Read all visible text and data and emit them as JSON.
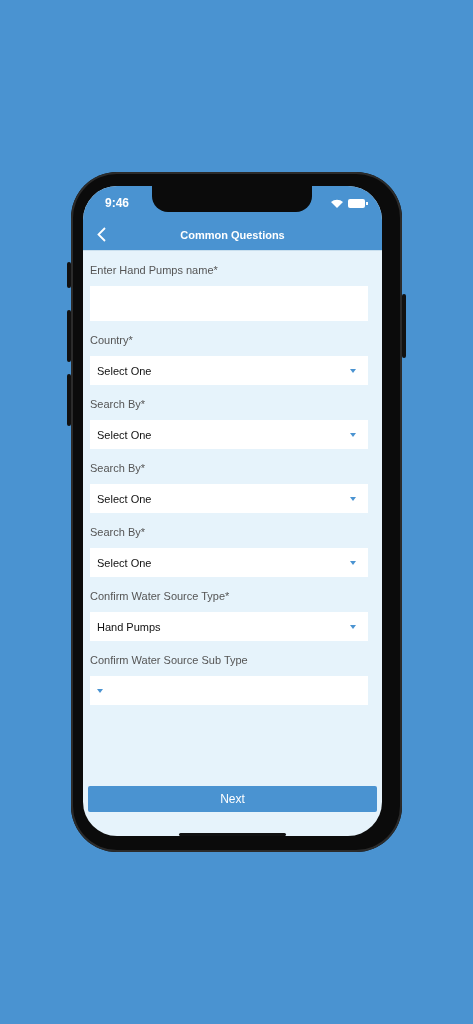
{
  "status_bar": {
    "time": "9:46"
  },
  "header": {
    "title": "Common Questions"
  },
  "fields": [
    {
      "kind": "text",
      "label": "Enter Hand Pumps name*"
    },
    {
      "kind": "select",
      "label": "Country*",
      "value": "Select One"
    },
    {
      "kind": "select",
      "label": "Search By*",
      "value": "Select One"
    },
    {
      "kind": "select",
      "label": "Search By*",
      "value": "Select One"
    },
    {
      "kind": "select",
      "label": "Search By*",
      "value": "Select One"
    },
    {
      "kind": "select",
      "label": "Confirm Water Source Type*",
      "value": "Hand Pumps"
    },
    {
      "kind": "select",
      "label": "Confirm Water Source Sub Type"
    }
  ],
  "button": "Next"
}
